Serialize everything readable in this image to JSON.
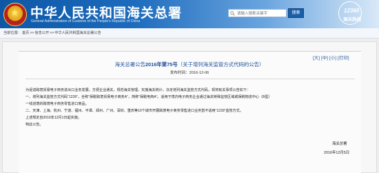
{
  "header": {
    "title": "中华人民共和国海关总署",
    "subtitle": "General Administration of Customs of the People's Republic of China",
    "search_placeholder": "请输入搜索关键字",
    "search_button": "搜索",
    "badge_number": "12360",
    "watermark": "海关热线"
  },
  "breadcrumb": {
    "prefix": "当前位置：",
    "items": [
      "首页",
      "信息公开",
      "中华人民共和国海关总署公告"
    ]
  },
  "font_size_controls": [
    "[大]",
    "[中]",
    "[小]",
    "[打印]"
  ],
  "notice": {
    "title_pre": "海关总署公告",
    "title_num": "2016年第75号",
    "title_post": "（关于增列海关监管方式代码的公告）",
    "date": "发布时间：2016-12-06",
    "paragraphs": [
      "为促进跨境贸易电子商务进出口业务发展，方便企业通关，规范海关管理，实施海关统计，决定增列海关监管方式代码，现将有关事项公告如下：",
      "一、增列海关监管方式代码“1239”，全称“保税跨境贸易电子商务A”，简称“保税电商A”。适用于境内电子商务企业通过海关特殊监管区域或保税物流中心（B型）",
      "一线进境的跨境电子商务零售进口商品。",
      "二、天津、上海、杭州、宁波、福州、平潭、郑州、广州、深圳、重庆等10个城市开展跨境电子商务零售进口业务暂不适用“1239”监管方式。",
      "上述规定自2016年12月1日起实施。",
      "特此公告。"
    ],
    "signature_org": "海关总署",
    "signature_date": "2016年12月5日"
  }
}
